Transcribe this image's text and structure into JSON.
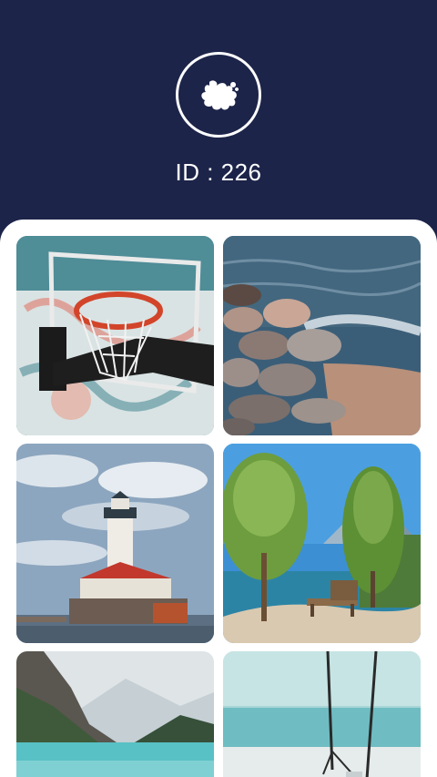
{
  "header": {
    "logo_icon": "puzzle-splash-icon",
    "id_text": "ID : 226"
  },
  "gallery": {
    "items": [
      {
        "subject": "basketball-hoop"
      },
      {
        "subject": "rocky-shore"
      },
      {
        "subject": "lighthouse"
      },
      {
        "subject": "lake-trees-bench"
      },
      {
        "subject": "mountain-lake"
      },
      {
        "subject": "beach-swing"
      }
    ]
  },
  "colors": {
    "header_bg": "#1c2449",
    "sheet_bg": "#ffffff",
    "text_light": "#ffffff"
  }
}
